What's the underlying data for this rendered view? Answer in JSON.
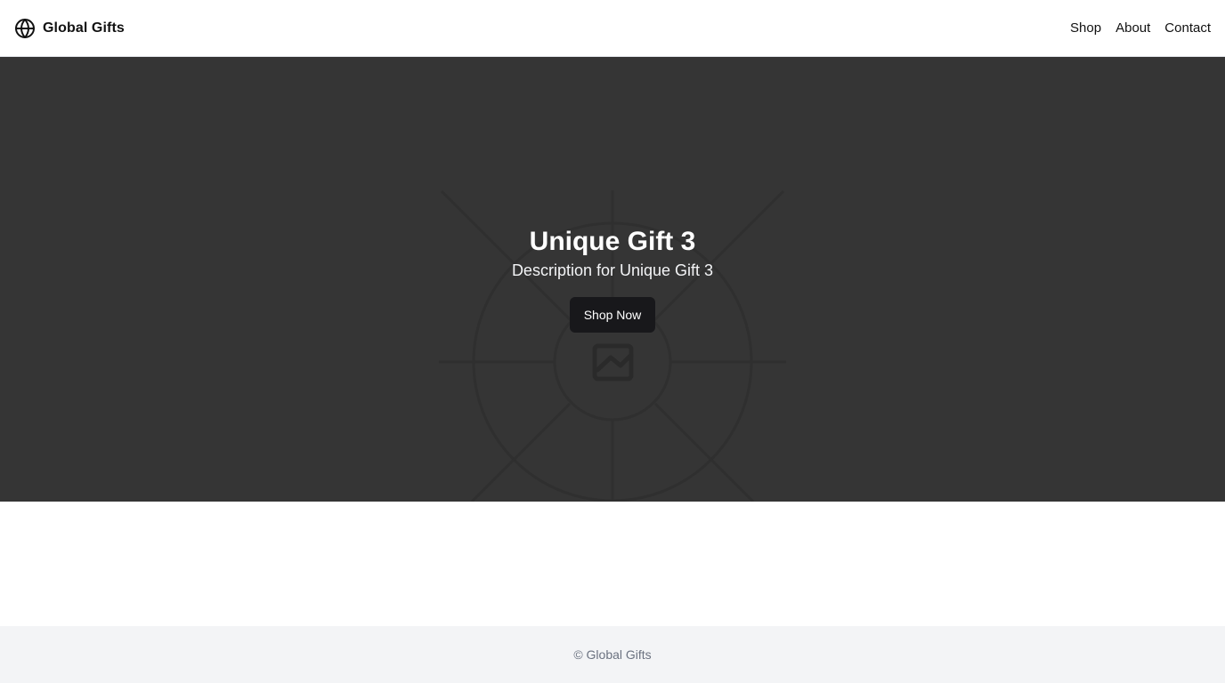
{
  "header": {
    "brand_icon": "globe-icon",
    "brand_name": "Global Gifts",
    "nav": [
      {
        "label": "Shop"
      },
      {
        "label": "About"
      },
      {
        "label": "Contact"
      }
    ]
  },
  "hero": {
    "background_icon": "image-placeholder-icon",
    "title": "Unique Gift 3",
    "subtitle": "Description for Unique Gift 3",
    "cta_label": "Shop Now"
  },
  "footer": {
    "text": "© Global Gifts"
  },
  "colors": {
    "hero_background": "#353535",
    "button_background": "#18181b",
    "footer_background": "#f3f4f6",
    "footer_text": "#6b7280"
  }
}
